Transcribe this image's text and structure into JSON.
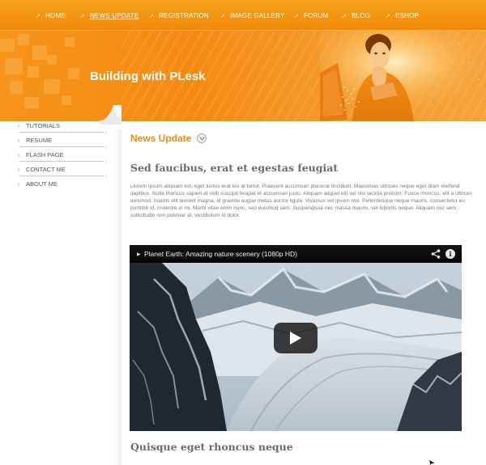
{
  "nav": {
    "items": [
      {
        "label": "HOME"
      },
      {
        "label": "NEWS UPDATE"
      },
      {
        "label": "REGISTRATION"
      },
      {
        "label": "IMAGE GALLERY"
      },
      {
        "label": "FORUM"
      },
      {
        "label": "BLOG"
      },
      {
        "label": "ESHOP"
      }
    ],
    "active": "NEWS UPDATE"
  },
  "banner": {
    "title": "Building with PLesk"
  },
  "sidebar": {
    "items": [
      {
        "label": "TUTORIALS"
      },
      {
        "label": "RESUME"
      },
      {
        "label": "FLASH PAGE"
      },
      {
        "label": "CONTACT ME"
      },
      {
        "label": "ABOUT ME"
      }
    ]
  },
  "main": {
    "section_title": "News Update",
    "article_title": "Sed faucibus, erat et egestas feugiat",
    "article_body": "Llorem ipsum aliquam est, eget luctus erat leo at tortor. Praesent accumsan placerat tincidunt. Maecenas ultricies neque eget diam eleifend dapibus. Nulla rhoncus sapien at velit suscipit feugiat et accumsan justo. Aliquam aliquet elit vel nisi lacinia pretium. Fusce rhoncus, elit a ultrices euismod, mauris elit laoreet magna, id gravida augue metus auctor ligula. Vivamus vel ipsum nisi. Pellentesque neque mauris, consectetur eu porttitor id, molestie in mi. Morbi vitae enim nunc, sed euismod sem. Suspendisse nec massa mauris, vel lobortis neque. Aliquam nisl sem, sollicitudin non pulvinar at, vestibulum id dolor.",
    "article_title_2": "Quisque eget rhoncus neque"
  },
  "video": {
    "title": "Planet Earth: Amazing nature scenery (1080p HD)"
  },
  "colors": {
    "accent": "#ee8a12",
    "nav_bg": "#f59411",
    "heading_gray": "#6b6b6b"
  }
}
